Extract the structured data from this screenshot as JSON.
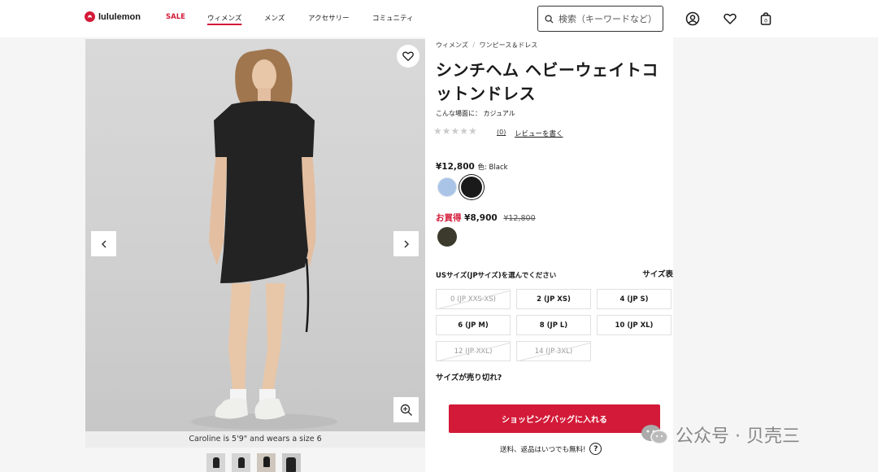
{
  "header": {
    "brand": "lululemon",
    "nav": [
      {
        "label": "SALE"
      },
      {
        "label": "ウィメンズ"
      },
      {
        "label": "メンズ"
      },
      {
        "label": "アクセサリー"
      },
      {
        "label": "コミュニティ"
      }
    ],
    "search_placeholder": "検索（キーワードなど）",
    "icons": [
      "search-icon",
      "account-icon",
      "heart-icon",
      "shopping-bag-icon"
    ],
    "bag_count": "0"
  },
  "gallery": {
    "caption": "Caroline is 5'9\" and wears a size 6",
    "icons": [
      "heart-icon",
      "chevron-left-icon",
      "chevron-right-icon",
      "zoom-in-icon"
    ],
    "thumbnail_count": 4
  },
  "product": {
    "breadcrumb": [
      "ウィメンズ",
      "/",
      "ワンピース＆ドレス"
    ],
    "title": "シンチヘム ヘビーウェイトコットンドレス",
    "occasion": "こんな場面に： カジュアル",
    "rating_count": "(0)",
    "write_review": "レビューを書く",
    "price": "¥12,800",
    "color_label": "色: Black",
    "swatches": [
      {
        "name": "light-blue",
        "color": "#a9c4e6"
      },
      {
        "name": "black",
        "color": "#1a1a1a"
      }
    ],
    "sale": {
      "label": "お買得",
      "price": "¥8,900",
      "original": "¥12,800",
      "swatch_color": "#3b3a2c"
    },
    "size_heading": "USサイズ(JPサイズ)を選んでください",
    "size_chart": "サイズ表",
    "sizes": [
      {
        "label": "0 (JP XXS-XS)",
        "available": false
      },
      {
        "label": "2 (JP XS)",
        "available": true
      },
      {
        "label": "4 (JP S)",
        "available": true
      },
      {
        "label": "6 (JP M)",
        "available": true
      },
      {
        "label": "8 (JP L)",
        "available": true
      },
      {
        "label": "10 (JP XL)",
        "available": true
      },
      {
        "label": "12 (JP XXL)",
        "available": false
      },
      {
        "label": "14 (JP 3XL)",
        "available": false
      }
    ],
    "sold_out_prompt": "サイズが売り切れ?",
    "add_to_bag": "ショッピングバッグに入れる",
    "shipping_note": "送料、返品はいつでも無料!",
    "help": "?"
  },
  "watermark": {
    "text": "公众号 · 贝壳三"
  },
  "colors": {
    "accent_red": "#d31a38"
  }
}
